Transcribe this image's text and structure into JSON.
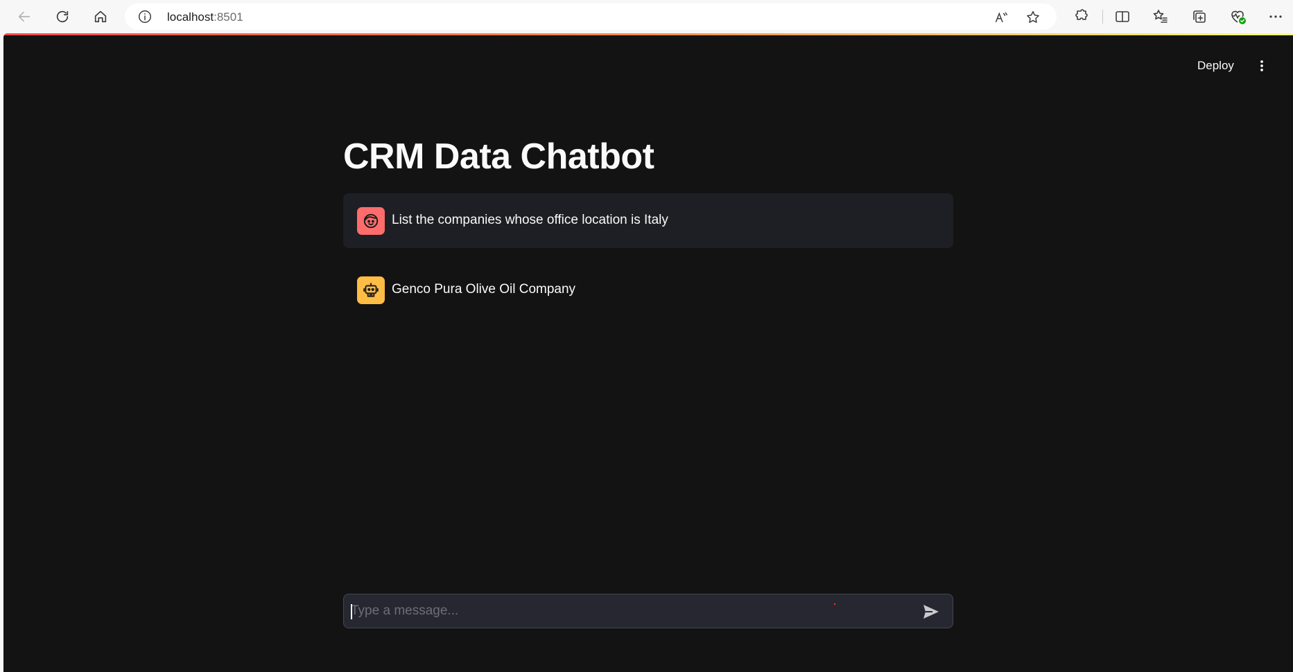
{
  "browser": {
    "url_host": "localhost",
    "url_port": ":8501",
    "icons": {
      "back": "arrow-left-icon",
      "refresh": "refresh-icon",
      "home": "home-icon",
      "site_info": "info-icon",
      "read_aloud": "read-aloud-icon",
      "favorite": "star-icon",
      "extensions": "puzzle-icon",
      "split_screen": "split-screen-icon",
      "favorites": "favorites-list-icon",
      "collections": "collections-icon",
      "health": "heart-check-icon",
      "more": "more-horizontal-icon"
    }
  },
  "header": {
    "deploy_label": "Deploy",
    "menu_icon": "more-vertical-icon"
  },
  "main": {
    "title": "CRM Data Chatbot",
    "messages": [
      {
        "role": "user",
        "text": "List the companies whose office location is Italy",
        "avatar_icon": "user-face-icon"
      },
      {
        "role": "assistant",
        "text": "Genco Pura Olive Oil Company",
        "avatar_icon": "robot-icon"
      }
    ]
  },
  "chat_input": {
    "placeholder": "Type a message...",
    "value": "",
    "send_icon": "send-icon"
  },
  "colors": {
    "app_background": "#131313",
    "user_message_bg": "#1e1f24",
    "user_avatar": "#ff6c6c",
    "assistant_avatar": "#ffbd45",
    "input_bg": "#262730",
    "text": "#fafafa"
  }
}
